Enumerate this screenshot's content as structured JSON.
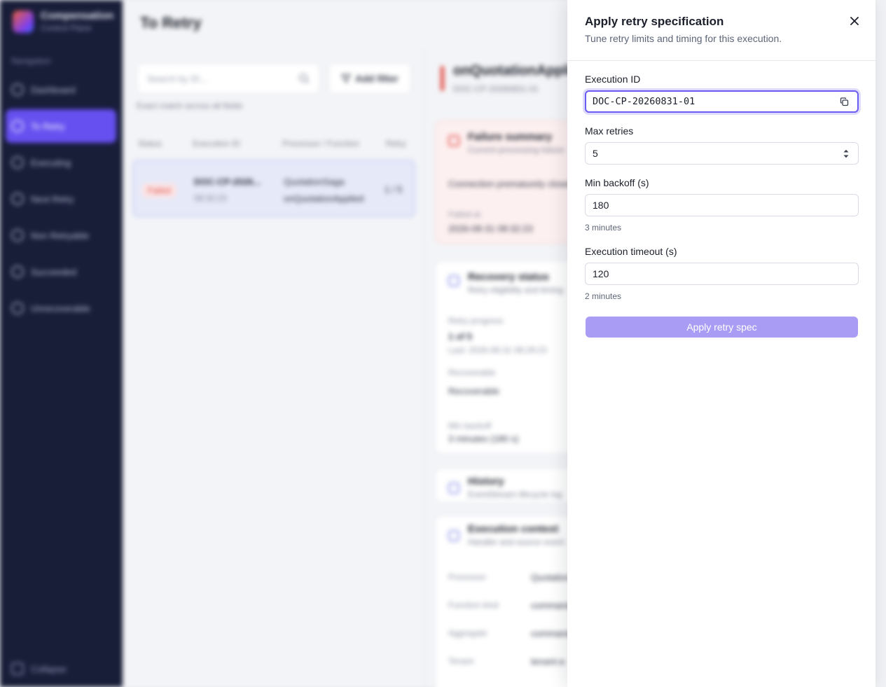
{
  "sidebar": {
    "brand_name": "Compensation",
    "brand_sub": "Control Plane",
    "section_heading": "Navigation",
    "items": [
      {
        "label": "Dashboard"
      },
      {
        "label": "To Retry"
      },
      {
        "label": "Executing"
      },
      {
        "label": "Next Retry"
      },
      {
        "label": "Non Retryable"
      },
      {
        "label": "Succeeded"
      },
      {
        "label": "Unrecoverable"
      }
    ],
    "active_item": "To Retry",
    "collapse_label": "Collapse"
  },
  "main": {
    "page_title": "To Retry",
    "search_placeholder": "Search by ID...",
    "filter_label": "Add filter",
    "hint": "Exact match across all fields",
    "columns": [
      "Status",
      "Execution ID",
      "Processor / Function",
      "Retry"
    ],
    "row": {
      "status": "Failed",
      "execution_id": "DOC-CP-2026...",
      "time": "08:32:23",
      "processor": "QuotationSaga",
      "function": "onQuotationApplied",
      "retry": "1 / 5"
    }
  },
  "detail": {
    "title": "onQuotationApplied",
    "subtitle": "DOC-CP-20260831-01",
    "failure": {
      "title": "Failure summary",
      "subtitle": "Current processing failure",
      "message": "Connection prematurely closed",
      "failed_at_label": "Failed at",
      "failed_at": "2026-08-31 08:32:23"
    },
    "recovery": {
      "title": "Recovery status",
      "subtitle": "Retry eligibility and timing",
      "progress_label": "Retry progress",
      "progress": "1 of 5",
      "last": "Last: 2026-08-31 08:29:23",
      "recoverable_label": "Recoverable",
      "recoverable_value": "Recoverable",
      "min_backoff_label": "Min backoff",
      "min_backoff": "3 minutes (180 s)"
    },
    "history": {
      "title": "History",
      "subtitle": "EventStream lifecycle log"
    },
    "context": {
      "title": "Execution context",
      "subtitle": "Handler and source event",
      "rows": [
        {
          "label": "Processor",
          "value": "Quotation"
        },
        {
          "label": "Function kind",
          "value": "command"
        },
        {
          "label": "Aggregate",
          "value": "command"
        },
        {
          "label": "Tenant",
          "value": "tenant-a"
        }
      ]
    }
  },
  "drawer": {
    "title": "Apply retry specification",
    "subtitle": "Tune retry limits and timing for this execution.",
    "execution_id_label": "Execution ID",
    "execution_id_value": "DOC-CP-20260831-01",
    "max_retries_label": "Max retries",
    "max_retries_value": "5",
    "min_backoff_label": "Min backoff (s)",
    "min_backoff_value": "180",
    "min_backoff_helper": "3 minutes",
    "execution_timeout_label": "Execution timeout (s)",
    "execution_timeout_value": "120",
    "execution_timeout_helper": "2 minutes",
    "apply_label": "Apply retry spec"
  },
  "colors": {
    "sidebar_bg": "#181d38",
    "accent": "#6650f0",
    "apply_button": "#a99cf5",
    "focus_ring": "#6a5cf0",
    "failed": "#e0453d"
  }
}
